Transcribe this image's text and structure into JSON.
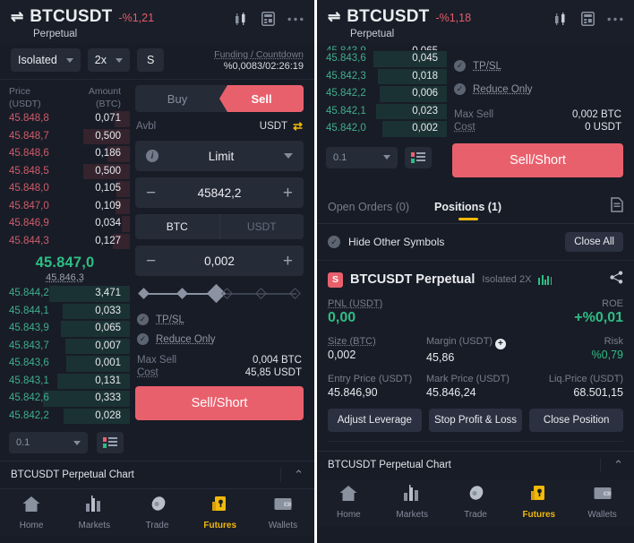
{
  "left": {
    "header": {
      "swap_icon": "⇌",
      "symbol": "BTCUSDT",
      "change": "-%1,21",
      "subtitle": "Perpetual",
      "icons": [
        "candles-icon",
        "calculator-icon",
        "more-icon"
      ]
    },
    "mode": {
      "margin_mode": "Isolated",
      "leverage": "2x",
      "preview": "S",
      "funding_label": "Funding / Countdown",
      "funding_value": "%0,0083/02:26:19"
    },
    "orderbook": {
      "col_price": "Price",
      "col_price_unit": "(USDT)",
      "col_amount": "Amount",
      "col_amount_unit": "(BTC)",
      "asks": [
        {
          "price": "45.848,8",
          "amount": "0,071",
          "depth": 14
        },
        {
          "price": "45.848,7",
          "amount": "0,500",
          "depth": 42
        },
        {
          "price": "45.848,6",
          "amount": "0,186",
          "depth": 20
        },
        {
          "price": "45.848,5",
          "amount": "0,500",
          "depth": 42
        },
        {
          "price": "45.848,0",
          "amount": "0,105",
          "depth": 12
        },
        {
          "price": "45.847,0",
          "amount": "0,109",
          "depth": 13
        },
        {
          "price": "45.846,9",
          "amount": "0,034",
          "depth": 7
        },
        {
          "price": "45.844,3",
          "amount": "0,127",
          "depth": 15
        }
      ],
      "last_price": "45.847,0",
      "mark_price": "45.846,3",
      "bids": [
        {
          "price": "45.844,2",
          "amount": "3,471",
          "depth": 72
        },
        {
          "price": "45.844,1",
          "amount": "0,033",
          "depth": 60
        },
        {
          "price": "45.843,9",
          "amount": "0,065",
          "depth": 62
        },
        {
          "price": "45.843,7",
          "amount": "0,007",
          "depth": 58
        },
        {
          "price": "45.843,6",
          "amount": "0,001",
          "depth": 57
        },
        {
          "price": "45.843,1",
          "amount": "0,131",
          "depth": 65
        },
        {
          "price": "45.842,6",
          "amount": "0,333",
          "depth": 78
        },
        {
          "price": "45.842,2",
          "amount": "0,028",
          "depth": 59
        }
      ],
      "grouping": "0.1",
      "depth_icon": "depth-view-icon"
    },
    "form": {
      "buy_label": "Buy",
      "sell_label": "Sell",
      "avbl_label": "Avbl",
      "avbl_currency": "USDT",
      "order_type": "Limit",
      "price_value": "45842,2",
      "qty_unit_on": "BTC",
      "qty_unit_off": "USDT",
      "qty_value": "0,002",
      "tpsl_label": "TP/SL",
      "reduce_only_label": "Reduce Only",
      "max_sell_label": "Max Sell",
      "max_sell_value": "0,004 BTC",
      "cost_label": "Cost",
      "cost_value": "45,85 USDT",
      "submit_label": "Sell/Short"
    },
    "chartbar": {
      "title": "BTCUSDT Perpetual  Chart",
      "chevron": "⌃"
    },
    "nav": [
      {
        "label": "Home",
        "icon": "home-icon",
        "active": false
      },
      {
        "label": "Markets",
        "icon": "markets-icon",
        "active": false
      },
      {
        "label": "Trade",
        "icon": "trade-icon",
        "active": false
      },
      {
        "label": "Futures",
        "icon": "futures-icon",
        "active": true
      },
      {
        "label": "Wallets",
        "icon": "wallets-icon",
        "active": false
      }
    ]
  },
  "right": {
    "header": {
      "swap_icon": "⇌",
      "symbol": "BTCUSDT",
      "change": "-%1,18",
      "subtitle": "Perpetual",
      "icons": [
        "candles-icon",
        "calculator-icon",
        "more-icon"
      ]
    },
    "orderbook": {
      "bids": [
        {
          "price": "45.843,6",
          "amount": "0,045",
          "depth": 66
        },
        {
          "price": "45.842,3",
          "amount": "0,018",
          "depth": 62
        },
        {
          "price": "45.842,2",
          "amount": "0,006",
          "depth": 60
        },
        {
          "price": "45.842,1",
          "amount": "0,023",
          "depth": 63
        },
        {
          "price": "45.842,0",
          "amount": "0,002",
          "depth": 58
        }
      ],
      "grouping": "0.1",
      "depth_icon": "depth-view-icon"
    },
    "form": {
      "tpsl_label": "TP/SL",
      "reduce_only_label": "Reduce Only",
      "max_sell_label": "Max Sell",
      "max_sell_value": "0,002 BTC",
      "cost_label": "Cost",
      "cost_value": "0 USDT",
      "submit_label": "Sell/Short"
    },
    "tabs": {
      "open_orders": "Open Orders (0)",
      "positions": "Positions (1)",
      "doc_icon": "document-icon"
    },
    "hidebar": {
      "hide_label": "Hide Other Symbols",
      "close_all": "Close All"
    },
    "position": {
      "side_badge": "S",
      "name": "BTCUSDT Perpetual",
      "mode": "Isolated 2X",
      "chart_icon": "mini-candles-icon",
      "share_icon": "share-icon",
      "pnl_label": "PNL (USDT)",
      "pnl_value": "0,00",
      "roe_label": "ROE",
      "roe_value": "+%0,01",
      "size_label": "Size (BTC)",
      "size_value": "0,002",
      "margin_label": "Margin (USDT)",
      "margin_value": "45,86",
      "risk_label": "Risk",
      "risk_value": "%0,79",
      "entry_label": "Entry Price (USDT)",
      "entry_value": "45.846,90",
      "mark_label": "Mark Price (USDT)",
      "mark_value": "45.846,24",
      "liq_label": "Liq.Price (USDT)",
      "liq_value": "68.501,15",
      "actions": [
        "Adjust Leverage",
        "Stop Profit & Loss",
        "Close Position"
      ]
    },
    "chartbar": {
      "title": "BTCUSDT Perpetual  Chart",
      "chevron": "⌃"
    },
    "nav": [
      {
        "label": "Home",
        "icon": "home-icon",
        "active": false
      },
      {
        "label": "Markets",
        "icon": "markets-icon",
        "active": false
      },
      {
        "label": "Trade",
        "icon": "trade-icon",
        "active": false
      },
      {
        "label": "Futures",
        "icon": "futures-icon",
        "active": true
      },
      {
        "label": "Wallets",
        "icon": "wallets-icon",
        "active": false
      }
    ]
  },
  "colors": {
    "bg": "#181c26",
    "panel_alt": "#1a1e29",
    "sell_red": "#e9606d",
    "buy_green": "#2ebd85",
    "accent_yellow": "#f0b90b",
    "ask_text": "#cf5d6b",
    "bid_text": "#3fae8e"
  }
}
